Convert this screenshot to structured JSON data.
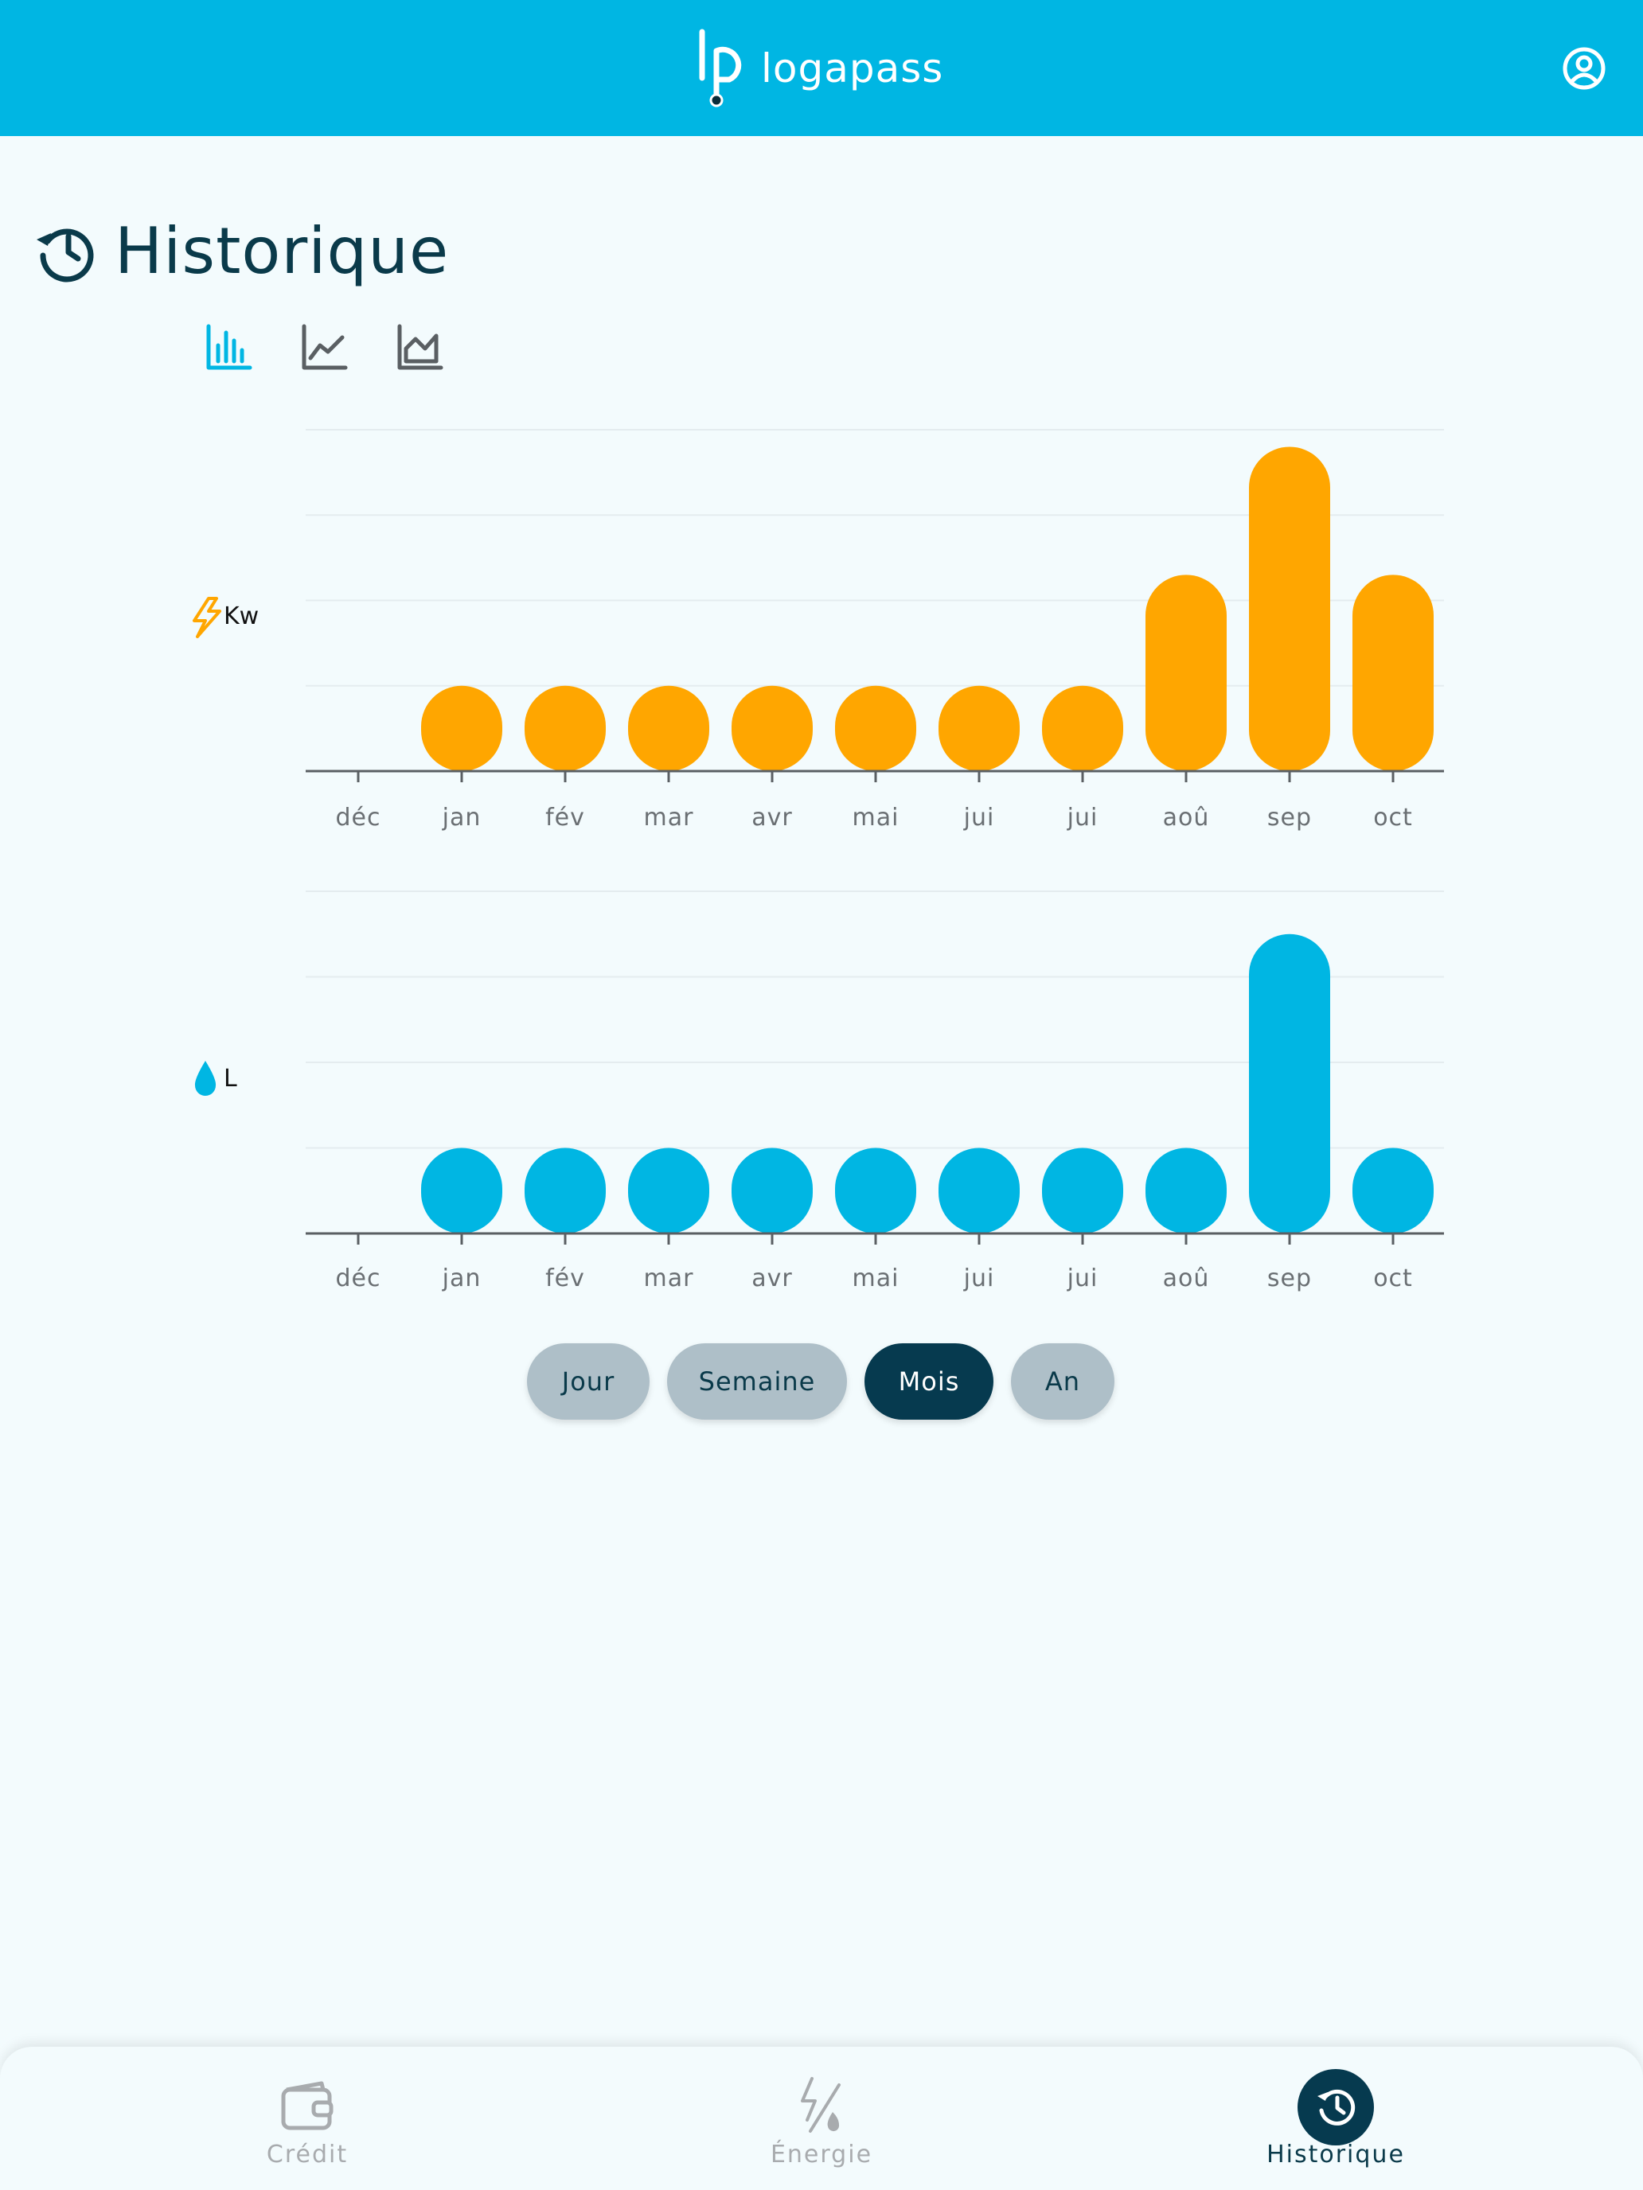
{
  "header": {
    "logo_text": "logapass",
    "profile_icon": "user-circle-icon",
    "brand_color": "#00b6e3"
  },
  "page": {
    "title": "Historique",
    "title_icon": "history-icon"
  },
  "chart_types": [
    {
      "name": "bar",
      "icon": "bar-chart-icon",
      "active": true
    },
    {
      "name": "line",
      "icon": "line-chart-icon",
      "active": false
    },
    {
      "name": "area",
      "icon": "area-chart-icon",
      "active": false
    }
  ],
  "chart_data": [
    {
      "type": "bar",
      "unit_label": "Kw",
      "unit_icon": "lightning-icon",
      "color": "#ffa600",
      "categories": [
        "déc",
        "jan",
        "fév",
        "mar",
        "avr",
        "mai",
        "jui",
        "jui",
        "aoû",
        "sep",
        "oct"
      ],
      "values": [
        0,
        1,
        1,
        1,
        1,
        1,
        1,
        1,
        2.3,
        3.8,
        2.3
      ],
      "ylim": [
        0,
        4
      ],
      "grid": true
    },
    {
      "type": "bar",
      "unit_label": "L",
      "unit_icon": "water-drop-icon",
      "color": "#00b6e3",
      "categories": [
        "déc",
        "jan",
        "fév",
        "mar",
        "avr",
        "mai",
        "jui",
        "jui",
        "aoû",
        "sep",
        "oct"
      ],
      "values": [
        0,
        1,
        1,
        1,
        1,
        1,
        1,
        1,
        1,
        3.5,
        1
      ],
      "ylim": [
        0,
        4
      ],
      "grid": true
    }
  ],
  "range_tabs": [
    {
      "label": "Jour",
      "active": false
    },
    {
      "label": "Semaine",
      "active": false
    },
    {
      "label": "Mois",
      "active": true
    },
    {
      "label": "An",
      "active": false
    }
  ],
  "bottom_nav": [
    {
      "label": "Crédit",
      "icon": "wallet-icon",
      "active": false
    },
    {
      "label": "Énergie",
      "icon": "energy-water-icon",
      "active": false
    },
    {
      "label": "Historique",
      "icon": "history-icon",
      "active": true
    }
  ]
}
